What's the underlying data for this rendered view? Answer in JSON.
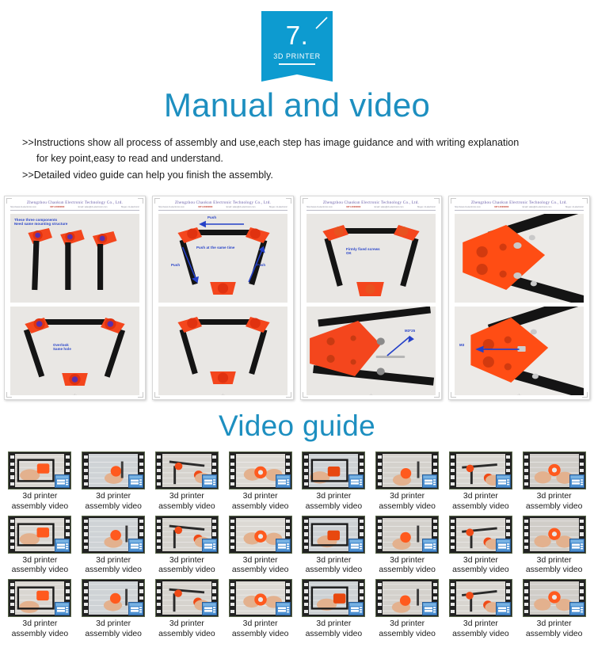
{
  "badge": {
    "number": "7.",
    "subtitle": "3D PRINTER",
    "color": "#0d9bd0",
    "tick_icon": "slash-tick-icon"
  },
  "page_title": "Manual and video",
  "title_color": "#1d8fc0",
  "intro": {
    "line1": ">>Instructions show all process of assembly and use,each step has image guidance and with writing explanation",
    "line2": "for key point,easy to read and understand.",
    "line3": ">>Detailed video guide can help you finish the assembly."
  },
  "manual": {
    "company_header": "Zhengzhou Chaokun Electronic Technology Co., Ltd.",
    "subheader_left": "http://www.ck-electronic.com",
    "subheader_hot": "0371-00000000",
    "subheader_mid": "Email: sales@ck-electronic.com",
    "subheader_right": "Skype: ck-electronic",
    "page_footer": "- 1 -",
    "pages": [
      {
        "id": "page-components",
        "top_annotation": "These three components\nNeed same mounting structure",
        "bottom_annotation": "Overlook\nSame hole"
      },
      {
        "id": "page-push-frame",
        "top_annotation": "Push",
        "top_annotation_2": "Push at the same time",
        "top_annotation_3": "Push",
        "top_annotation_4": "Push",
        "bottom_annotation": ""
      },
      {
        "id": "page-fixed-screws",
        "top_annotation": "Firmly fixed screws\nOK",
        "bottom_annotation": "M3*25"
      },
      {
        "id": "page-corner-detail",
        "top_annotation": "",
        "bottom_annotation": "M3"
      }
    ]
  },
  "video_section": {
    "title": "Video guide",
    "caption_line1": "3d printer",
    "caption_line2": "assembly video",
    "columns": 8,
    "rows": 3,
    "total": 24,
    "icon": "video-file-icon",
    "items": [
      {
        "scene": "hands-holding-frame-panel"
      },
      {
        "scene": "hand-with-orange-corner-part"
      },
      {
        "scene": "hand-assembling-corner"
      },
      {
        "scene": "hand-placing-orange-part"
      },
      {
        "scene": "frame-rod-assembly"
      },
      {
        "scene": "hands-on-orange-joint"
      },
      {
        "scene": "hands-holding-orange-part"
      },
      {
        "scene": "hand-with-orange-piece-on-table"
      },
      {
        "scene": "hand-gripping-orange-corner"
      },
      {
        "scene": "triangle-frame-on-table"
      },
      {
        "scene": "hands-working-on-rods"
      },
      {
        "scene": "hands-tightening-joint"
      },
      {
        "scene": "orange-parts-close-up"
      },
      {
        "scene": "hands-holding-frame-side"
      },
      {
        "scene": "hand-with-red-block"
      },
      {
        "scene": "hand-holding-small-part"
      },
      {
        "scene": "hands-assembling-screws"
      },
      {
        "scene": "orange-part-with-tools"
      },
      {
        "scene": "hands-holding-round-part"
      },
      {
        "scene": "vertical-rod-with-bracket"
      },
      {
        "scene": "hand-with-orange-bracket-rod"
      },
      {
        "scene": "hands-using-screwdriver"
      },
      {
        "scene": "hands-with-black-rod-tool"
      },
      {
        "scene": "hands-holding-assembled-frame"
      }
    ]
  }
}
